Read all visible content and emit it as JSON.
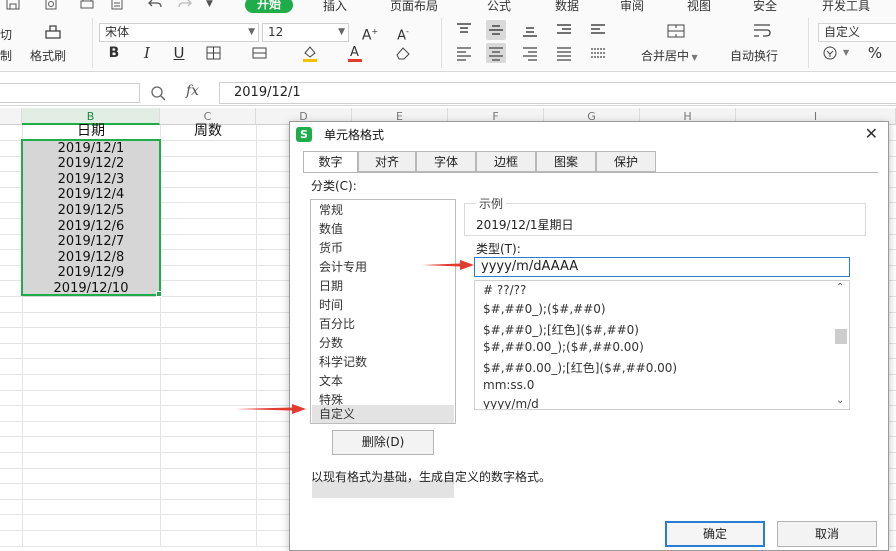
{
  "quick_icons": [
    "save-icon",
    "print-preview-icon",
    "print-icon",
    "undo-icon",
    "redo-icon",
    "dropdown-icon"
  ],
  "menu_tabs": [
    "开始",
    "插入",
    "页面布局",
    "公式",
    "数据",
    "审阅",
    "视图",
    "安全",
    "开发工具"
  ],
  "ribbon": {
    "cut_label": "切",
    "paste_label": "制",
    "format_painter_label": "格式刷",
    "font_name": "宋体",
    "font_size": "12",
    "bold": "B",
    "italic": "I",
    "underline": "U",
    "merge_center_label": "合并居中",
    "wrap_text_label": "自动换行",
    "number_format": "自定义",
    "percent": "%"
  },
  "formula_bar": {
    "fx_label": "fx",
    "value": "2019/12/1"
  },
  "grid": {
    "columns": [
      "B",
      "C",
      "D",
      "E",
      "F",
      "G",
      "H",
      "I"
    ],
    "header_b": "日期",
    "header_c": "周数",
    "dates": [
      "2019/12/1",
      "2019/12/2",
      "2019/12/3",
      "2019/12/4",
      "2019/12/5",
      "2019/12/6",
      "2019/12/7",
      "2019/12/8",
      "2019/12/9",
      "2019/12/10"
    ]
  },
  "dialog": {
    "title": "单元格格式",
    "logo": "S",
    "tabs": [
      "数字",
      "对齐",
      "字体",
      "边框",
      "图案",
      "保护"
    ],
    "category_label": "分类(C):",
    "categories": [
      "常规",
      "数值",
      "货币",
      "会计专用",
      "日期",
      "时间",
      "百分比",
      "分数",
      "科学记数",
      "文本",
      "特殊",
      "自定义"
    ],
    "selected_category": "自定义",
    "sample_label": "示例",
    "sample_value": "2019/12/1星期日",
    "type_label": "类型(T):",
    "type_value": "yyyy/m/dAAAA",
    "format_list": [
      "# ??/??",
      "$#,##0_);($#,##0)",
      "$#,##0_);[红色]($#,##0)",
      "$#,##0.00_);($#,##0.00)",
      "$#,##0.00_);[红色]($#,##0.00)",
      "mm:ss.0",
      "yyyy/m/d"
    ],
    "delete_button": "删除(D)",
    "description": "以现有格式为基础，生成自定义的数字格式。",
    "ok_button": "确定",
    "cancel_button": "取消"
  },
  "colors": {
    "accent_green": "#1fad4a",
    "arrow_red": "#e23b2f",
    "focus_blue": "#2a7dd1"
  }
}
